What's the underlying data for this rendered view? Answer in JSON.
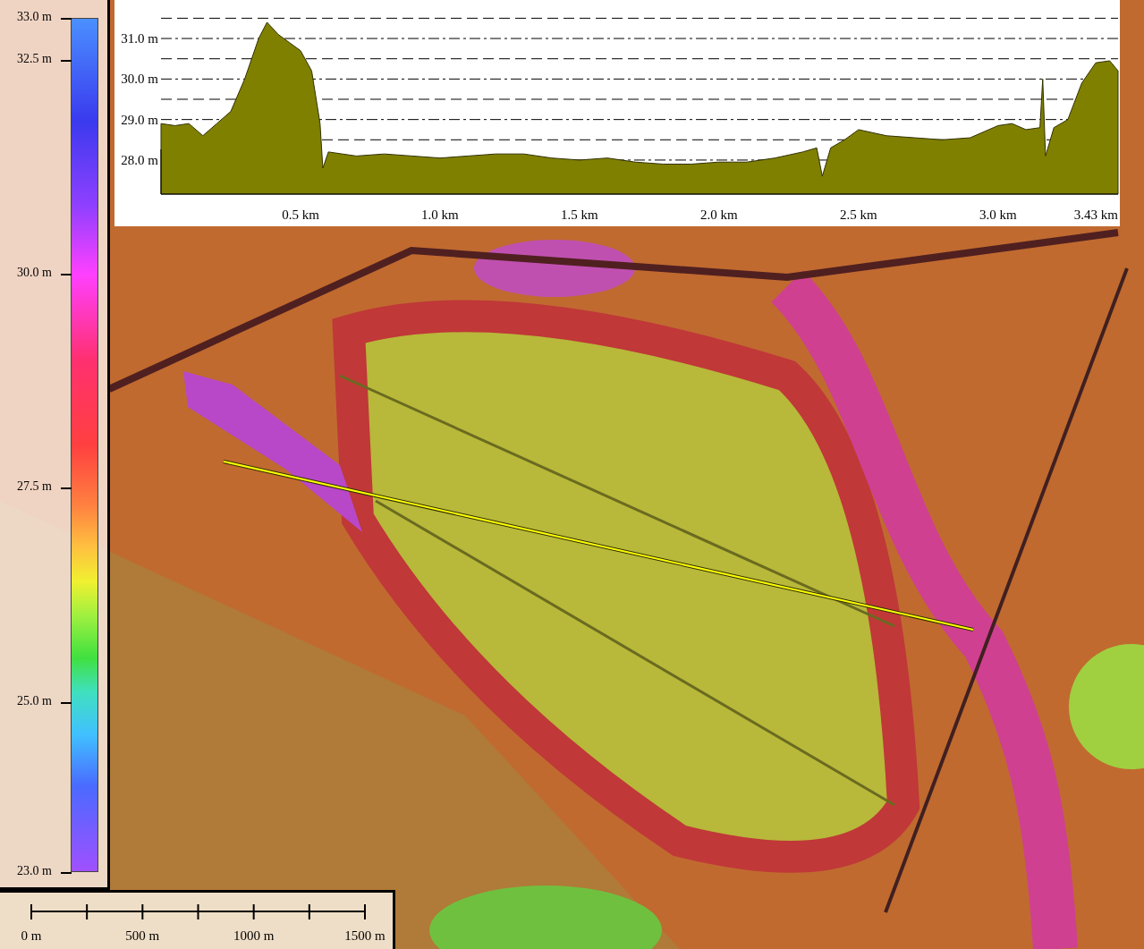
{
  "legend": {
    "ticks": [
      "33.0 m",
      "32.5 m",
      "30.0 m",
      "27.5 m",
      "25.0 m",
      "23.0 m"
    ]
  },
  "profile": {
    "chart_data": {
      "type": "area",
      "grid": true,
      "xlim": [
        0,
        3.43
      ],
      "ylim": [
        27.16,
        31.95
      ],
      "x": [
        0,
        0.05,
        0.1,
        0.15,
        0.2,
        0.25,
        0.3,
        0.35,
        0.38,
        0.42,
        0.46,
        0.5,
        0.54,
        0.57,
        0.58,
        0.6,
        0.7,
        0.8,
        0.9,
        1.0,
        1.1,
        1.2,
        1.3,
        1.4,
        1.5,
        1.6,
        1.7,
        1.8,
        1.9,
        2.0,
        2.1,
        2.2,
        2.3,
        2.35,
        2.37,
        2.4,
        2.45,
        2.5,
        2.6,
        2.7,
        2.8,
        2.9,
        3.0,
        3.05,
        3.1,
        3.15,
        3.16,
        3.17,
        3.2,
        3.25,
        3.3,
        3.35,
        3.4,
        3.43
      ],
      "series": [
        {
          "color": "#808000",
          "values": [
            28.9,
            28.85,
            28.9,
            28.6,
            28.9,
            29.2,
            30.0,
            31.0,
            31.4,
            31.1,
            30.9,
            30.7,
            30.2,
            28.9,
            27.8,
            28.2,
            28.1,
            28.15,
            28.1,
            28.05,
            28.1,
            28.15,
            28.15,
            28.05,
            28.0,
            28.05,
            27.95,
            27.9,
            27.9,
            27.95,
            27.95,
            28.05,
            28.2,
            28.3,
            27.6,
            28.3,
            28.5,
            28.75,
            28.6,
            28.55,
            28.5,
            28.55,
            28.85,
            28.9,
            28.75,
            28.8,
            30.0,
            28.1,
            28.8,
            29.0,
            29.9,
            30.4,
            30.45,
            30.2
          ]
        }
      ],
      "xticks": [
        {
          "value": 0.5,
          "label": "0.5 km"
        },
        {
          "value": 1.0,
          "label": "1.0 km"
        },
        {
          "value": 1.5,
          "label": "1.5 km"
        },
        {
          "value": 2.0,
          "label": "2.0 km"
        },
        {
          "value": 2.5,
          "label": "2.5 km"
        },
        {
          "value": 3.0,
          "label": "3.0 km"
        },
        {
          "value": 3.43,
          "label": "3.43 km"
        }
      ],
      "yticks": [
        {
          "value": 28,
          "label": "28.0 m"
        },
        {
          "value": 29,
          "label": "29.0 m"
        },
        {
          "value": 30,
          "label": "30.0 m"
        },
        {
          "value": 31,
          "label": "31.0 m"
        }
      ]
    }
  },
  "scale_bar": {
    "labels": [
      "0 m",
      "500 m",
      "1000 m",
      "1500 m"
    ]
  }
}
